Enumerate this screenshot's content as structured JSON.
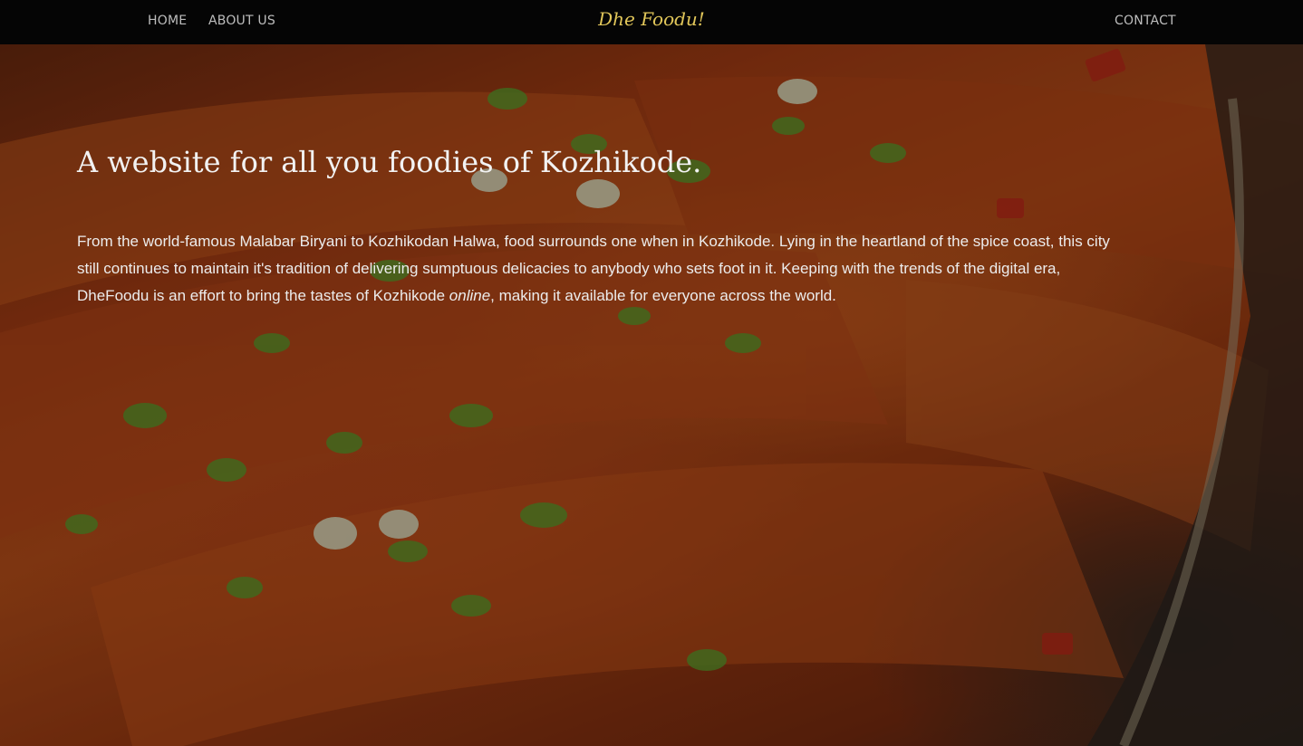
{
  "nav": {
    "home_label": "HOME",
    "about_label": "ABOUT US",
    "brand": "Dhe Foodu!",
    "contact_label": "CONTACT"
  },
  "hero": {
    "title": "A website for all you foodies of Kozhikode.",
    "text_before": "From the world-famous Malabar Biryani to Kozhikodan Halwa, food surrounds one when in Kozhikode. Lying in the heartland of the spice coast, this city still continues to maintain it's tradition of delivering sumptuous delicacies to anybody who sets foot in it. Keeping with the trends of the digital era, DheFoodu is an effort to bring the tastes of Kozhikode ",
    "text_emphasis": "online",
    "text_after": ", making it available for everyone across the world."
  },
  "colors": {
    "navbar_bg": "#050505",
    "nav_link": "#bdbdbd",
    "brand": "#e2c75a",
    "hero_text": "#ececec"
  }
}
